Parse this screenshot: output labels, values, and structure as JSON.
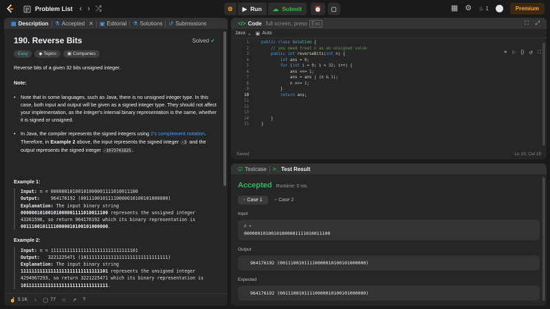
{
  "topbar": {
    "title": "Problem List",
    "run_label": "Run",
    "submit_label": "Submit",
    "streak": "1",
    "premium_label": "Premium"
  },
  "description_panel": {
    "tabs": [
      {
        "label": "Description"
      },
      {
        "label": "Accepted"
      },
      {
        "label": "Editorial"
      },
      {
        "label": "Solutions"
      },
      {
        "label": "Submissions"
      }
    ],
    "problem_title": "190. Reverse Bits",
    "solved_label": "Solved",
    "difficulty": "Easy",
    "topics_label": "Topics",
    "companies_label": "Companies",
    "statement": "Reverse bits of a given 32 bits unsigned integer.",
    "note_heading": "Note:",
    "note_1": "Note that in some languages, such as Java, there is no unsigned integer type. In this case, both input and output will be given as a signed integer type. They should not affect your implementation, as the integer's internal binary representation is the same, whether it is signed or unsigned.",
    "note_2_a": "In Java, the compiler represents the signed integers using ",
    "note_2_link": "2's complement notation",
    "note_2_b": ". Therefore, in ",
    "note_2_bold": "Example 2",
    "note_2_c": " above, the input represents the signed integer ",
    "note_2_code1": "-3",
    "note_2_d": " and the output represents the signed integer ",
    "note_2_code2": "-1073741825",
    "note_2_e": ".",
    "examples": [
      {
        "title": "Example 1:",
        "input_label": "Input:",
        "input": "n = 00000010100101000001111010011100",
        "output_label": "Output:",
        "output": "   964176192 (00111001011110000010100101000000)",
        "expl_label": "Explanation:",
        "expl_1": "The input binary string",
        "expl_bold1": "00000010100101000001111010011100",
        "expl_2": " represents the unsigned integer 43261596, so return 964176192 which its binary representation is ",
        "expl_bold2": "00111001011110000010100101000000",
        "expl_end": "."
      },
      {
        "title": "Example 2:",
        "input_label": "Input:",
        "input": "n = 11111111111111111111111111111101",
        "output_label": "Output:",
        "output": "  3221225471 (10111111111111111111111111111111)",
        "expl_label": "Explanation:",
        "expl_1": "The input binary string",
        "expl_bold1": "11111111111111111111111111111101",
        "expl_2": " represents the unsigned integer 4294967293, so return 3221225471 which its binary representation is ",
        "expl_bold2": "10111111111111111111111111111111",
        "expl_end": "."
      }
    ],
    "footer": {
      "likes": "5.1K",
      "comments": "77"
    }
  },
  "code_panel": {
    "tab_label": "Code",
    "overlay_text": "full screen, press",
    "esc_label": "Esc",
    "language": "Java",
    "mode": "Auto",
    "line_numbers": [
      "1",
      "2",
      "3",
      "4",
      "5",
      "6",
      "7",
      "8",
      "9",
      "10",
      "11",
      "12",
      "13",
      "14",
      "15"
    ],
    "status_saved": "Saved",
    "cursor_position": "Ln 10, Col 19"
  },
  "result_panel": {
    "tabs": [
      {
        "label": "Testcase"
      },
      {
        "label": "Test Result"
      }
    ],
    "verdict": "Accepted",
    "runtime": "Runtime: 0 ms",
    "cases": [
      "Case 1",
      "Case 2"
    ],
    "input_label": "Input",
    "input_var": "n =",
    "input_value": "00000010100101000001111010011100",
    "output_label": "Output",
    "output_value": "964176192 (00111001011110000010100101000000)",
    "expected_label": "Expected",
    "expected_value": "964176192 (00111001011110000010100101000000)"
  },
  "colors": {
    "accent": "#ffa116",
    "accepted": "#2cbb5d",
    "easy": "#46c6c2",
    "link": "#4a9cf5"
  }
}
